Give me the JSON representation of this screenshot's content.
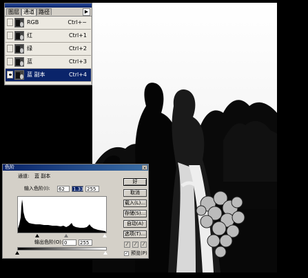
{
  "palette": {
    "tabs": [
      "图层",
      "通道",
      "路径"
    ],
    "menu_icon": "triangle-right-icon",
    "channels": [
      {
        "name": "RGB",
        "shortcut": "Ctrl+~",
        "visible": false,
        "selected": false
      },
      {
        "name": "红",
        "shortcut": "Ctrl+1",
        "visible": false,
        "selected": false
      },
      {
        "name": "绿",
        "shortcut": "Ctrl+2",
        "visible": false,
        "selected": false
      },
      {
        "name": "蓝",
        "shortcut": "Ctrl+3",
        "visible": false,
        "selected": false
      },
      {
        "name": "蓝 副本",
        "shortcut": "Ctrl+4",
        "visible": true,
        "selected": true
      }
    ]
  },
  "levels": {
    "title": "色阶",
    "channel_label": "通道:",
    "channel_value": "蓝 副本",
    "input_label": "输入色阶(I):",
    "input_values": [
      "62",
      "1.33",
      "255"
    ],
    "output_label": "输出色阶(O):",
    "output_values": [
      "0",
      "255"
    ],
    "buttons": {
      "ok": "好",
      "cancel": "取消",
      "load": "载入(L)...",
      "save": "存储(S)...",
      "auto": "自动(A)",
      "options": "选项(T)..."
    },
    "preview_label": "预览(P)",
    "preview_checked": true
  },
  "colors": {
    "selection": "#0a246a",
    "panel": "#d4d0c8"
  }
}
